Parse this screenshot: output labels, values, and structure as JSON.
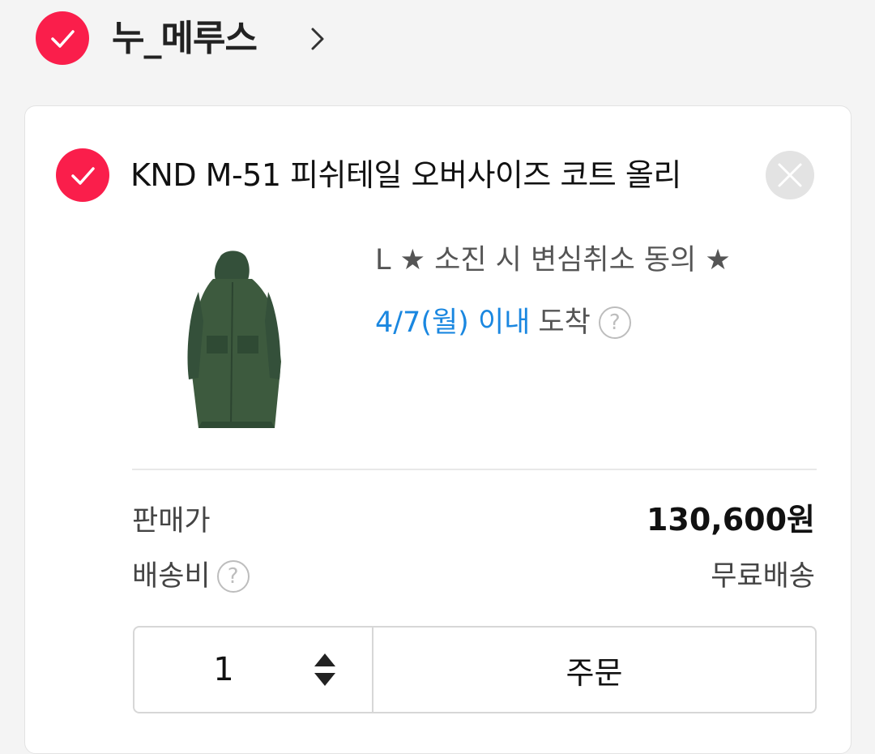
{
  "store": {
    "name": "누_메루스",
    "checked": true
  },
  "item": {
    "checked": true,
    "name": "KND M-51 피쉬테일 오버사이즈 코트 올리",
    "image_icon": "coat-thumbnail",
    "option": "L ★ 소진 시 변심취소 동의 ★",
    "delivery_date": "4/7(월) 이내",
    "delivery_suffix": "도착",
    "help_glyph": "?"
  },
  "pricing": {
    "price_label": "판매가",
    "price_value": "130,600원",
    "shipping_label": "배송비",
    "shipping_value": "무료배송"
  },
  "order": {
    "quantity": "1",
    "order_label": "주문"
  },
  "colors": {
    "accent": "#fa1e4b",
    "link": "#1a87e0",
    "coat": "#3d5a3e"
  }
}
